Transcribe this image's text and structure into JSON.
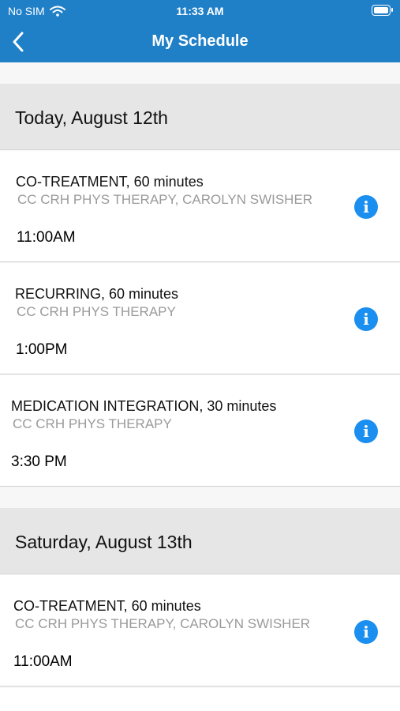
{
  "status_bar": {
    "carrier": "No SIM",
    "time": "11:33 AM"
  },
  "nav": {
    "title": "My Schedule"
  },
  "sections": [
    {
      "date": "Today, August 12th",
      "appointments": [
        {
          "title": "CO-TREATMENT, 60 minutes",
          "location": "CC CRH PHYS THERAPY, CAROLYN SWISHER",
          "time": "11:00AM"
        },
        {
          "title": "RECURRING, 60 minutes",
          "location": "CC CRH PHYS THERAPY",
          "time": "1:00PM"
        },
        {
          "title": "MEDICATION INTEGRATION, 30 minutes",
          "location": "CC CRH PHYS THERAPY",
          "time": "3:30 PM"
        }
      ]
    },
    {
      "date": "Saturday, August 13th",
      "appointments": [
        {
          "title": "CO-TREATMENT, 60 minutes",
          "location": "CC CRH PHYS THERAPY, CAROLYN SWISHER",
          "time": "11:00AM"
        }
      ]
    }
  ],
  "info_glyph": "i",
  "colors": {
    "header": "#1f7fc7",
    "info_icon": "#1b8ff0",
    "section_bg": "#e6e6e6"
  }
}
